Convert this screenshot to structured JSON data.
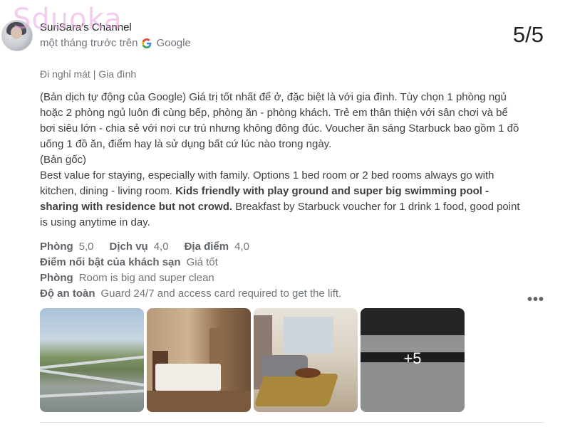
{
  "watermark": "Sduoka",
  "review": {
    "reviewer_name": "SuriSara's Channel",
    "time": "một tháng trước trên",
    "source": "Google",
    "score": "5/5",
    "trip_type": "Đi nghỉ mát | Gia đình",
    "translated_text": "(Bản dịch tự động của Google) Giá trị tốt nhất để ở, đặc biệt là với gia đình. Tùy chọn 1 phòng ngủ hoặc 2 phòng ngủ luôn đi cùng bếp, phòng ăn - phòng khách. Trẻ em thân thiện với sân chơi và bể bơi siêu lớn - chia sẻ với nơi cư trú nhưng không đông đúc. Voucher ăn sáng Starbuck bao gồm 1 đồ uống 1 đồ ăn, điểm hay là sử dụng bất cứ lúc nào trong ngày.",
    "original_label": "(Bản gốc)",
    "original_text_a": "Best value for staying, especially with family. Options 1 bed room or 2 bed rooms always go with kitchen, dining - living room.",
    "original_text_bold": "Kids friendly with play ground and super big swimming pool - sharing with residence but not crowd.",
    "original_text_b": "Breakfast by Starbuck voucher for 1 drink 1 food, good point is using anytime in day."
  },
  "ratings": {
    "room_label": "Phòng",
    "room_value": "5,0",
    "service_label": "Dịch vụ",
    "service_value": "4,0",
    "location_label": "Địa điểm",
    "location_value": "4,0",
    "highlight_label": "Điểm nổi bật của khách sạn",
    "highlight_value": "Giá tốt",
    "room_note_label": "Phòng",
    "room_note_value": "Room is big and super clean",
    "safety_label": "Độ an toàn",
    "safety_value": "Guard 24/7 and access card required to get the lift."
  },
  "more_label": "•••",
  "photos": {
    "more_count": "+5"
  }
}
